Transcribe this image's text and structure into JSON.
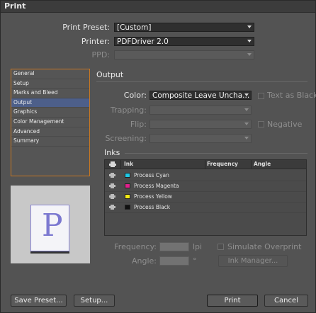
{
  "window": {
    "title": "Print"
  },
  "top": {
    "preset_label": "Print Preset:",
    "preset_value": "[Custom]",
    "printer_label": "Printer:",
    "printer_value": "PDFDriver 2.0",
    "ppd_label": "PPD:",
    "ppd_value": ""
  },
  "sidebar": {
    "items": [
      {
        "label": "General"
      },
      {
        "label": "Setup"
      },
      {
        "label": "Marks and Bleed"
      },
      {
        "label": "Output"
      },
      {
        "label": "Graphics"
      },
      {
        "label": "Color Management"
      },
      {
        "label": "Advanced"
      },
      {
        "label": "Summary"
      }
    ],
    "selected_index": 3
  },
  "preview": {
    "letter": "P"
  },
  "output": {
    "heading": "Output",
    "color_label": "Color:",
    "color_value": "Composite Leave Uncha...",
    "text_as_black_label": "Text as Black",
    "trapping_label": "Trapping:",
    "flip_label": "Flip:",
    "negative_label": "Negative",
    "screening_label": "Screening:"
  },
  "inks": {
    "heading": "Inks",
    "columns": {
      "ink": "Ink",
      "frequency": "Frequency",
      "angle": "Angle"
    },
    "rows": [
      {
        "name": "Process Cyan",
        "color": "#1ec8e6"
      },
      {
        "name": "Process Magenta",
        "color": "#e0208c"
      },
      {
        "name": "Process Yellow",
        "color": "#f2ea14"
      },
      {
        "name": "Process Black",
        "color": "#111111"
      }
    ]
  },
  "controls": {
    "frequency_label": "Frequency:",
    "frequency_unit": "lpi",
    "angle_label": "Angle:",
    "angle_unit": "°",
    "simulate_overprint_label": "Simulate Overprint",
    "ink_manager_label": "Ink Manager..."
  },
  "footer": {
    "save_preset": "Save Preset...",
    "setup": "Setup...",
    "print": "Print",
    "cancel": "Cancel"
  }
}
